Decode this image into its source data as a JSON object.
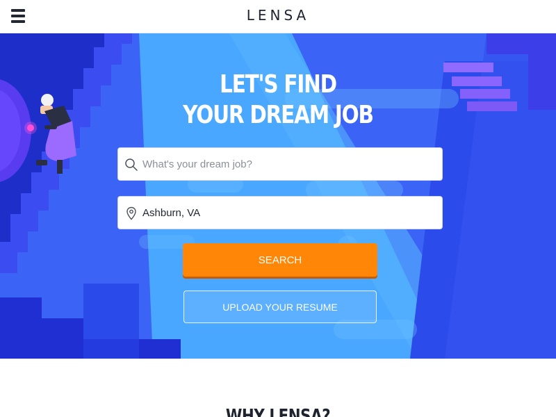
{
  "header": {
    "menu_icon": "hamburger-menu-icon",
    "logo_text": "LENSA"
  },
  "hero": {
    "title_line1": "LET'S FIND",
    "title_line2": "YOUR DREAM JOB",
    "job_field": {
      "icon": "search-icon",
      "placeholder": "What's your dream job?",
      "value": ""
    },
    "location_field": {
      "icon": "location-pin-icon",
      "placeholder": "",
      "value": "Ashburn, VA"
    },
    "search_label": "SEARCH",
    "upload_label": "UPLOAD YOUR RESUME",
    "illustration": "worker-with-flashlight-on-stairs",
    "colors": {
      "background_blue": "#3b63f5",
      "light_blue": "#4aa7ff",
      "dark_blue": "#1f2fd1",
      "violet": "#7f5cf6",
      "search_orange": "#ff8606"
    }
  },
  "why": {
    "title": "WHY LENSA?"
  }
}
